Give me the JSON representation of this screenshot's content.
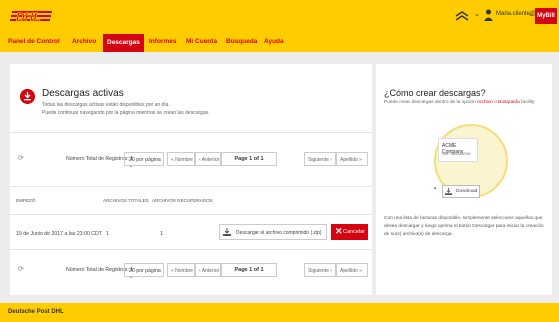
{
  "header": {
    "logo": "DHL",
    "user_email": "Maria.cliente@dhl.com",
    "mydhl": "MyBill",
    "colors": {
      "brand_yellow": "#ffcc00",
      "brand_red": "#d40511"
    }
  },
  "nav": {
    "items": [
      "Panel de Control",
      "Archivo",
      "Descargas",
      "Informes",
      "Mi Cuenta",
      "Búsqueda",
      "Ayuda"
    ],
    "active": "Descargas"
  },
  "main": {
    "title": "Descargas activas",
    "subtitle1": "Todas las descargas activas están disponibles por un día.",
    "subtitle2": "Puede continuar navegando por la página mientras se crean las descargas.",
    "pager": {
      "total": "Número Total de Registros: 1",
      "per_page": "20 por página",
      "first": "« Nombre",
      "prev": "‹ Anterior",
      "page": "Page 1 of 1",
      "next": "Siguiente ›",
      "last": "Apellido »"
    },
    "columns": {
      "started": "EMPEZÓ",
      "total": "ARCHIVOS TOTALES",
      "recovered": "ARCHIVOS RECUPERADOS"
    },
    "row": {
      "date": "19 de Junio de 2017 a las 23:00 CDT",
      "total": "1",
      "recovered": "1",
      "download_label": "Descargar el archivo comprimido (.zip)",
      "cancel_label": "Cancelar"
    }
  },
  "side": {
    "title": "¿Cómo crear descargas?",
    "intro_pre": "Puede crear descargas dentro de la opción ",
    "link1": "Archivo",
    "intro_mid": " o ",
    "link2": "Búsqueda",
    "intro_post": " facility",
    "card_name": "ACME Company",
    "card_ref": "Ref: 960369709",
    "button": "Download",
    "body": "Con una lista de facturas disponible, simplemente seleccione aquellos que desea descargar y luego oprima el botón Descargar para iniciar la creación de su(s) archivo(s) de descarga."
  },
  "footer": {
    "text": "Deutsche Post DHL"
  }
}
